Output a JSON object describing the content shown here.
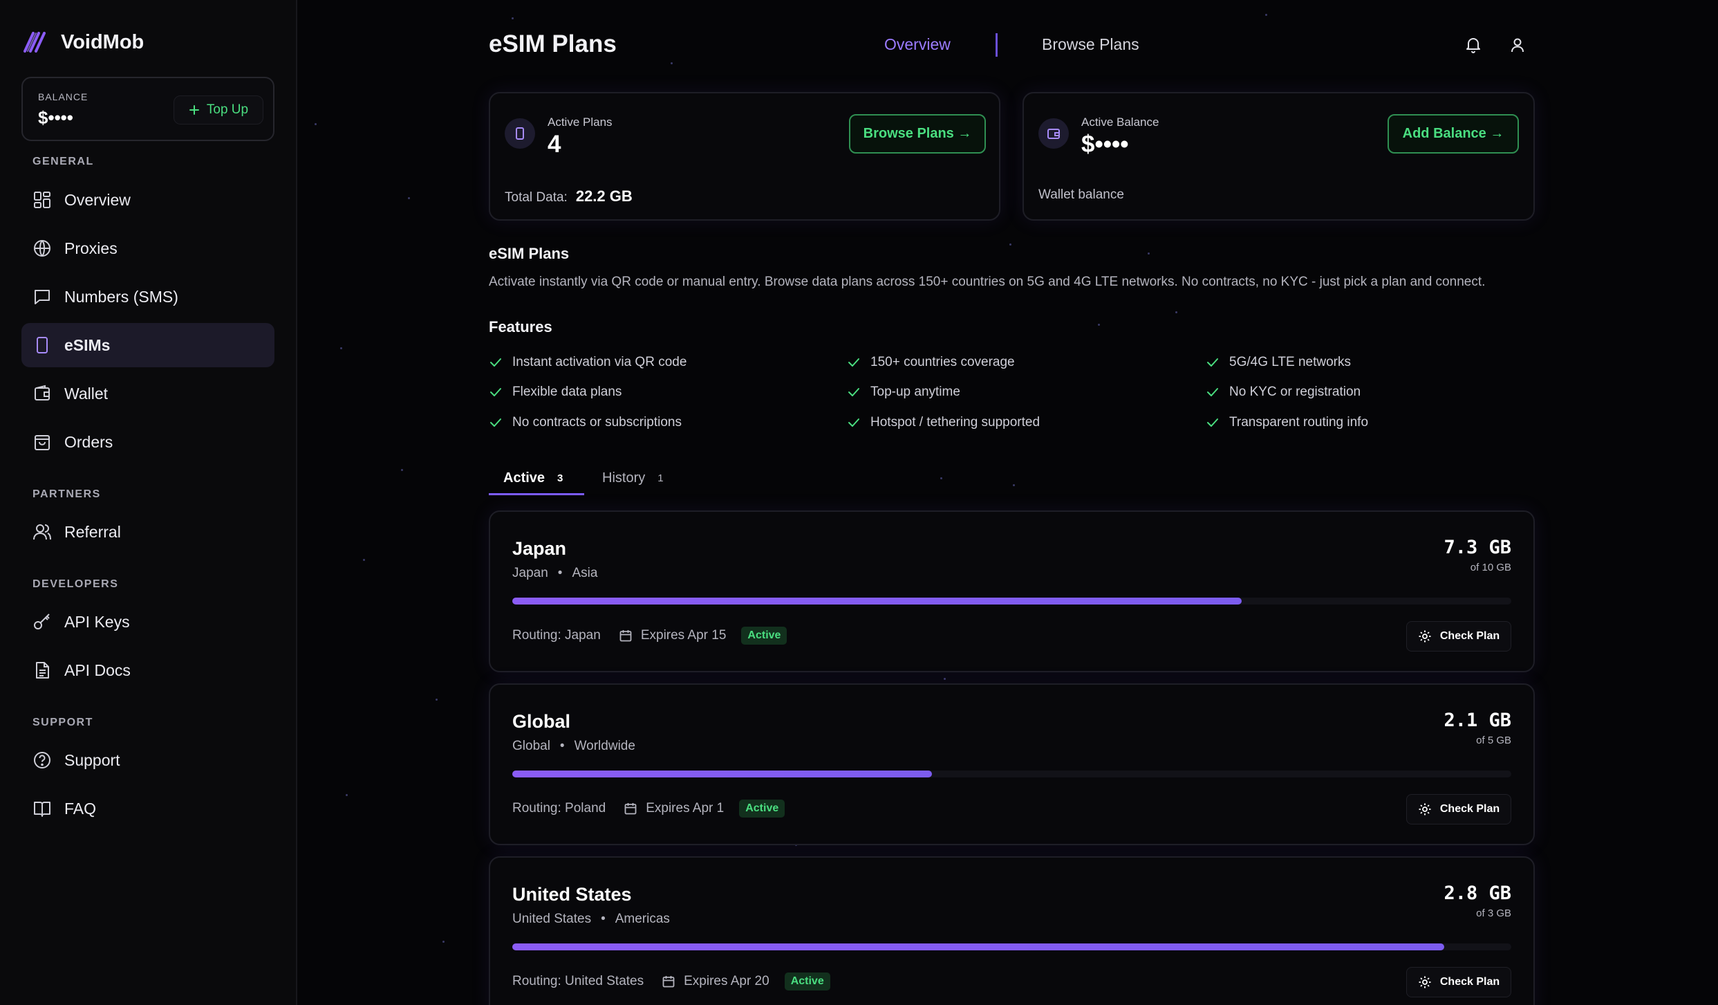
{
  "brand": {
    "name": "VoidMob"
  },
  "balance_box": {
    "label": "BALANCE",
    "value": "$••••",
    "topup_label": "Top Up"
  },
  "nav": {
    "general_heading": "GENERAL",
    "partners_heading": "PARTNERS",
    "developers_heading": "DEVELOPERS",
    "support_heading": "SUPPORT",
    "items": [
      {
        "label": "Overview",
        "icon": "grid-icon"
      },
      {
        "label": "Proxies",
        "icon": "globe-icon"
      },
      {
        "label": "Numbers (SMS)",
        "icon": "message-icon"
      },
      {
        "label": "eSIMs",
        "icon": "sim-icon",
        "active": true
      },
      {
        "label": "Wallet",
        "icon": "wallet-icon"
      },
      {
        "label": "Orders",
        "icon": "bag-icon"
      },
      {
        "label": "Referral",
        "icon": "users-icon"
      },
      {
        "label": "API Keys",
        "icon": "key-icon"
      },
      {
        "label": "API Docs",
        "icon": "document-icon"
      },
      {
        "label": "Support",
        "icon": "help-icon"
      },
      {
        "label": "FAQ",
        "icon": "book-icon"
      }
    ]
  },
  "header": {
    "title": "eSIM Plans",
    "tabs": [
      {
        "label": "Overview",
        "selected": true
      },
      {
        "label": "Browse Plans"
      }
    ]
  },
  "stats": {
    "active_plans": {
      "label": "Active Plans",
      "value": "4",
      "button": "Browse Plans →",
      "foot_label": "Total Data:",
      "foot_value": "22.2 GB"
    },
    "active_balance": {
      "label": "Active Balance",
      "value": "$••••",
      "button": "Add Balance →",
      "foot_label": "Wallet balance"
    }
  },
  "intro": {
    "title": "eSIM Plans",
    "description": "Activate instantly via QR code or manual entry. Browse data plans across 150+ countries on 5G and 4G LTE networks. No contracts, no KYC - just pick a plan and connect."
  },
  "features": {
    "title": "Features",
    "items": [
      "Instant activation via QR code",
      "150+ countries coverage",
      "5G/4G LTE networks",
      "Flexible data plans",
      "Top-up anytime",
      "No KYC or registration",
      "No contracts or subscriptions",
      "Hotspot / tethering supported",
      "Transparent routing info"
    ]
  },
  "plan_tabs": [
    {
      "label": "Active",
      "count": "3",
      "selected": true
    },
    {
      "label": "History",
      "count": "1"
    }
  ],
  "plans": [
    {
      "name": "Japan",
      "country": "Japan",
      "region": "Asia",
      "used": "7.3 GB",
      "total": "of 10 GB",
      "usage_fraction": 0.73,
      "routing": "Routing: Japan",
      "expires": "Expires Apr 15",
      "status": "Active",
      "button": "Check Plan"
    },
    {
      "name": "Global",
      "country": "Global",
      "region": "Worldwide",
      "used": "2.1 GB",
      "total": "of 5 GB",
      "usage_fraction": 0.42,
      "routing": "Routing: Poland",
      "expires": "Expires Apr 1",
      "status": "Active",
      "button": "Check Plan"
    },
    {
      "name": "United States",
      "country": "United States",
      "region": "Americas",
      "used": "2.8 GB",
      "total": "of 3 GB",
      "usage_fraction": 0.933,
      "routing": "Routing: United States",
      "expires": "Expires Apr 20",
      "status": "Active",
      "button": "Check Plan"
    }
  ],
  "colors": {
    "accent": "#8b5cf6",
    "success": "#4ade80",
    "background": "#050507",
    "sidebar": "#0a0a0c"
  }
}
